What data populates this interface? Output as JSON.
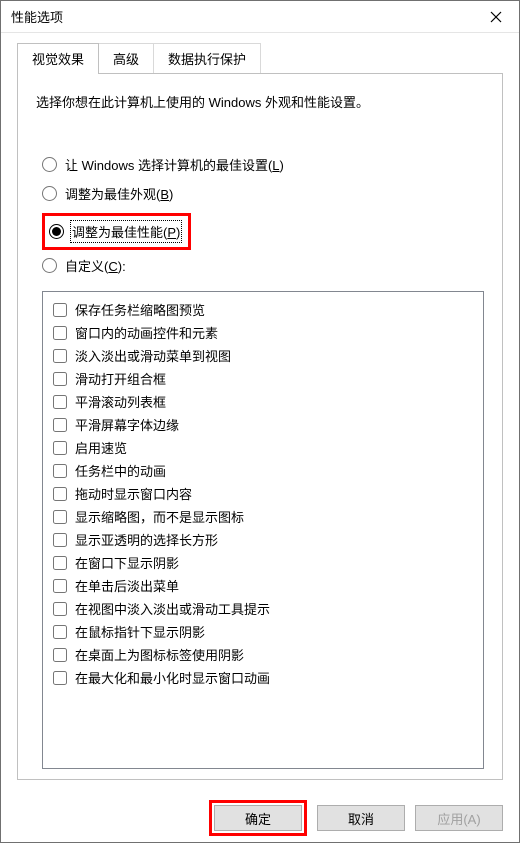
{
  "window": {
    "title": "性能选项"
  },
  "tabs": {
    "visual": "视觉效果",
    "advanced": "高级",
    "dep": "数据执行保护"
  },
  "panel": {
    "description": "选择你想在此计算机上使用的 Windows 外观和性能设置。"
  },
  "radios": {
    "let_windows": "让 Windows 选择计算机的最佳设置(",
    "let_windows_key": "L",
    "let_windows_tail": ")",
    "best_appearance": "调整为最佳外观(",
    "best_appearance_key": "B",
    "best_appearance_tail": ")",
    "best_performance": "调整为最佳性能(",
    "best_performance_key": "P",
    "best_performance_tail": ")",
    "custom": "自定义(",
    "custom_key": "C",
    "custom_tail": "):"
  },
  "checks": [
    "保存任务栏缩略图预览",
    "窗口内的动画控件和元素",
    "淡入淡出或滑动菜单到视图",
    "滑动打开组合框",
    "平滑滚动列表框",
    "平滑屏幕字体边缘",
    "启用速览",
    "任务栏中的动画",
    "拖动时显示窗口内容",
    "显示缩略图，而不是显示图标",
    "显示亚透明的选择长方形",
    "在窗口下显示阴影",
    "在单击后淡出菜单",
    "在视图中淡入淡出或滑动工具提示",
    "在鼠标指针下显示阴影",
    "在桌面上为图标标签使用阴影",
    "在最大化和最小化时显示窗口动画"
  ],
  "buttons": {
    "ok": "确定",
    "cancel": "取消",
    "apply": "应用(A)"
  }
}
